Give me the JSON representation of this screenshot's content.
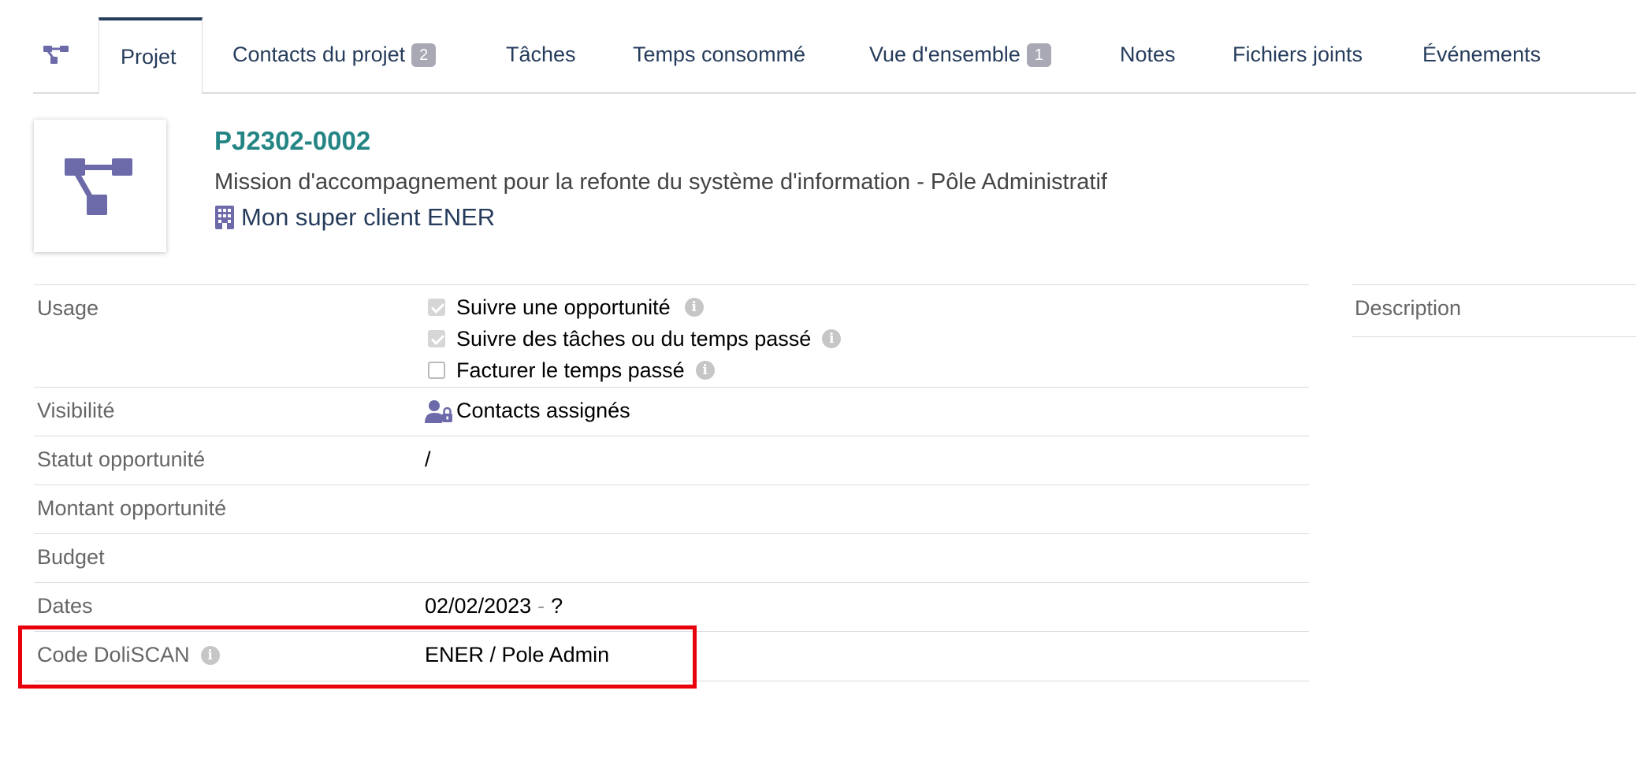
{
  "tabs": [
    {
      "label": "Projet",
      "active": true
    },
    {
      "label": "Contacts du projet",
      "badge": "2"
    },
    {
      "label": "Tâches"
    },
    {
      "label": "Temps consommé"
    },
    {
      "label": "Vue d'ensemble",
      "badge": "1"
    },
    {
      "label": "Notes"
    },
    {
      "label": "Fichiers joints"
    },
    {
      "label": "Événements"
    }
  ],
  "header": {
    "ref": "PJ2302-0002",
    "title": "Mission d'accompagnement pour la refonte du système d'information - Pôle Administratif",
    "client": "Mon super client ENER",
    "icon": "project-icon",
    "client_icon": "building-icon"
  },
  "fields": {
    "usage": {
      "label": "Usage",
      "options": [
        {
          "label": "Suivre une opportunité",
          "checked": true
        },
        {
          "label": "Suivre des tâches ou du temps passé",
          "checked": true
        },
        {
          "label": "Facturer le temps passé",
          "checked": false
        }
      ]
    },
    "visibility": {
      "label": "Visibilité",
      "value": "Contacts assignés",
      "icon": "user-lock-icon"
    },
    "opp_status": {
      "label": "Statut opportunité",
      "value": "/"
    },
    "opp_amount": {
      "label": "Montant opportunité",
      "value": ""
    },
    "budget": {
      "label": "Budget",
      "value": ""
    },
    "dates": {
      "label": "Dates",
      "start": "02/02/2023",
      "separator": "-",
      "end": "?"
    },
    "doliscan": {
      "label": "Code DoliSCAN",
      "value": "ENER / Pole Admin"
    }
  },
  "description": {
    "label": "Description"
  },
  "colors": {
    "accent": "#263c5c",
    "ref": "#258585",
    "icon": "#6c6aa8",
    "highlight": "#e8000b"
  }
}
